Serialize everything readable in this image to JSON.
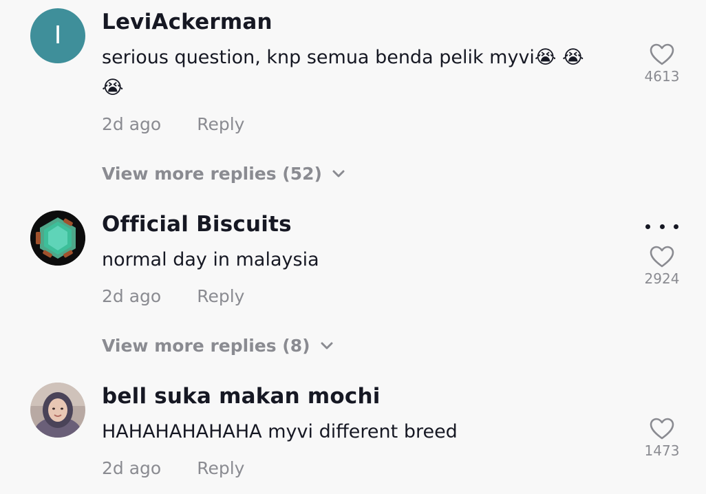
{
  "comments": [
    {
      "username": "LeviAckerman",
      "avatar_letter": "I",
      "text": "serious question, knp semua benda pelik myvi😭 😭 😭",
      "time": "2d ago",
      "reply_label": "Reply",
      "like_count": "4613",
      "view_more": "View more replies (52)"
    },
    {
      "username": "Official Biscuits",
      "text": "normal day in malaysia",
      "time": "2d ago",
      "reply_label": "Reply",
      "like_count": "2924",
      "view_more": "View more replies (8)"
    },
    {
      "username": "bell suka makan mochi",
      "text": "HAHAHAHAHAHA myvi different breed",
      "time": "2d ago",
      "reply_label": "Reply",
      "like_count": "1473"
    }
  ],
  "icons": {
    "like": "heart-outline-icon",
    "more": "more-options-icon",
    "expand": "chevron-down-icon"
  },
  "colors": {
    "background": "#f8f8f8",
    "text_primary": "#161823",
    "text_secondary": "#8a8b91",
    "avatar_letter_bg": "#3f8f9a"
  }
}
